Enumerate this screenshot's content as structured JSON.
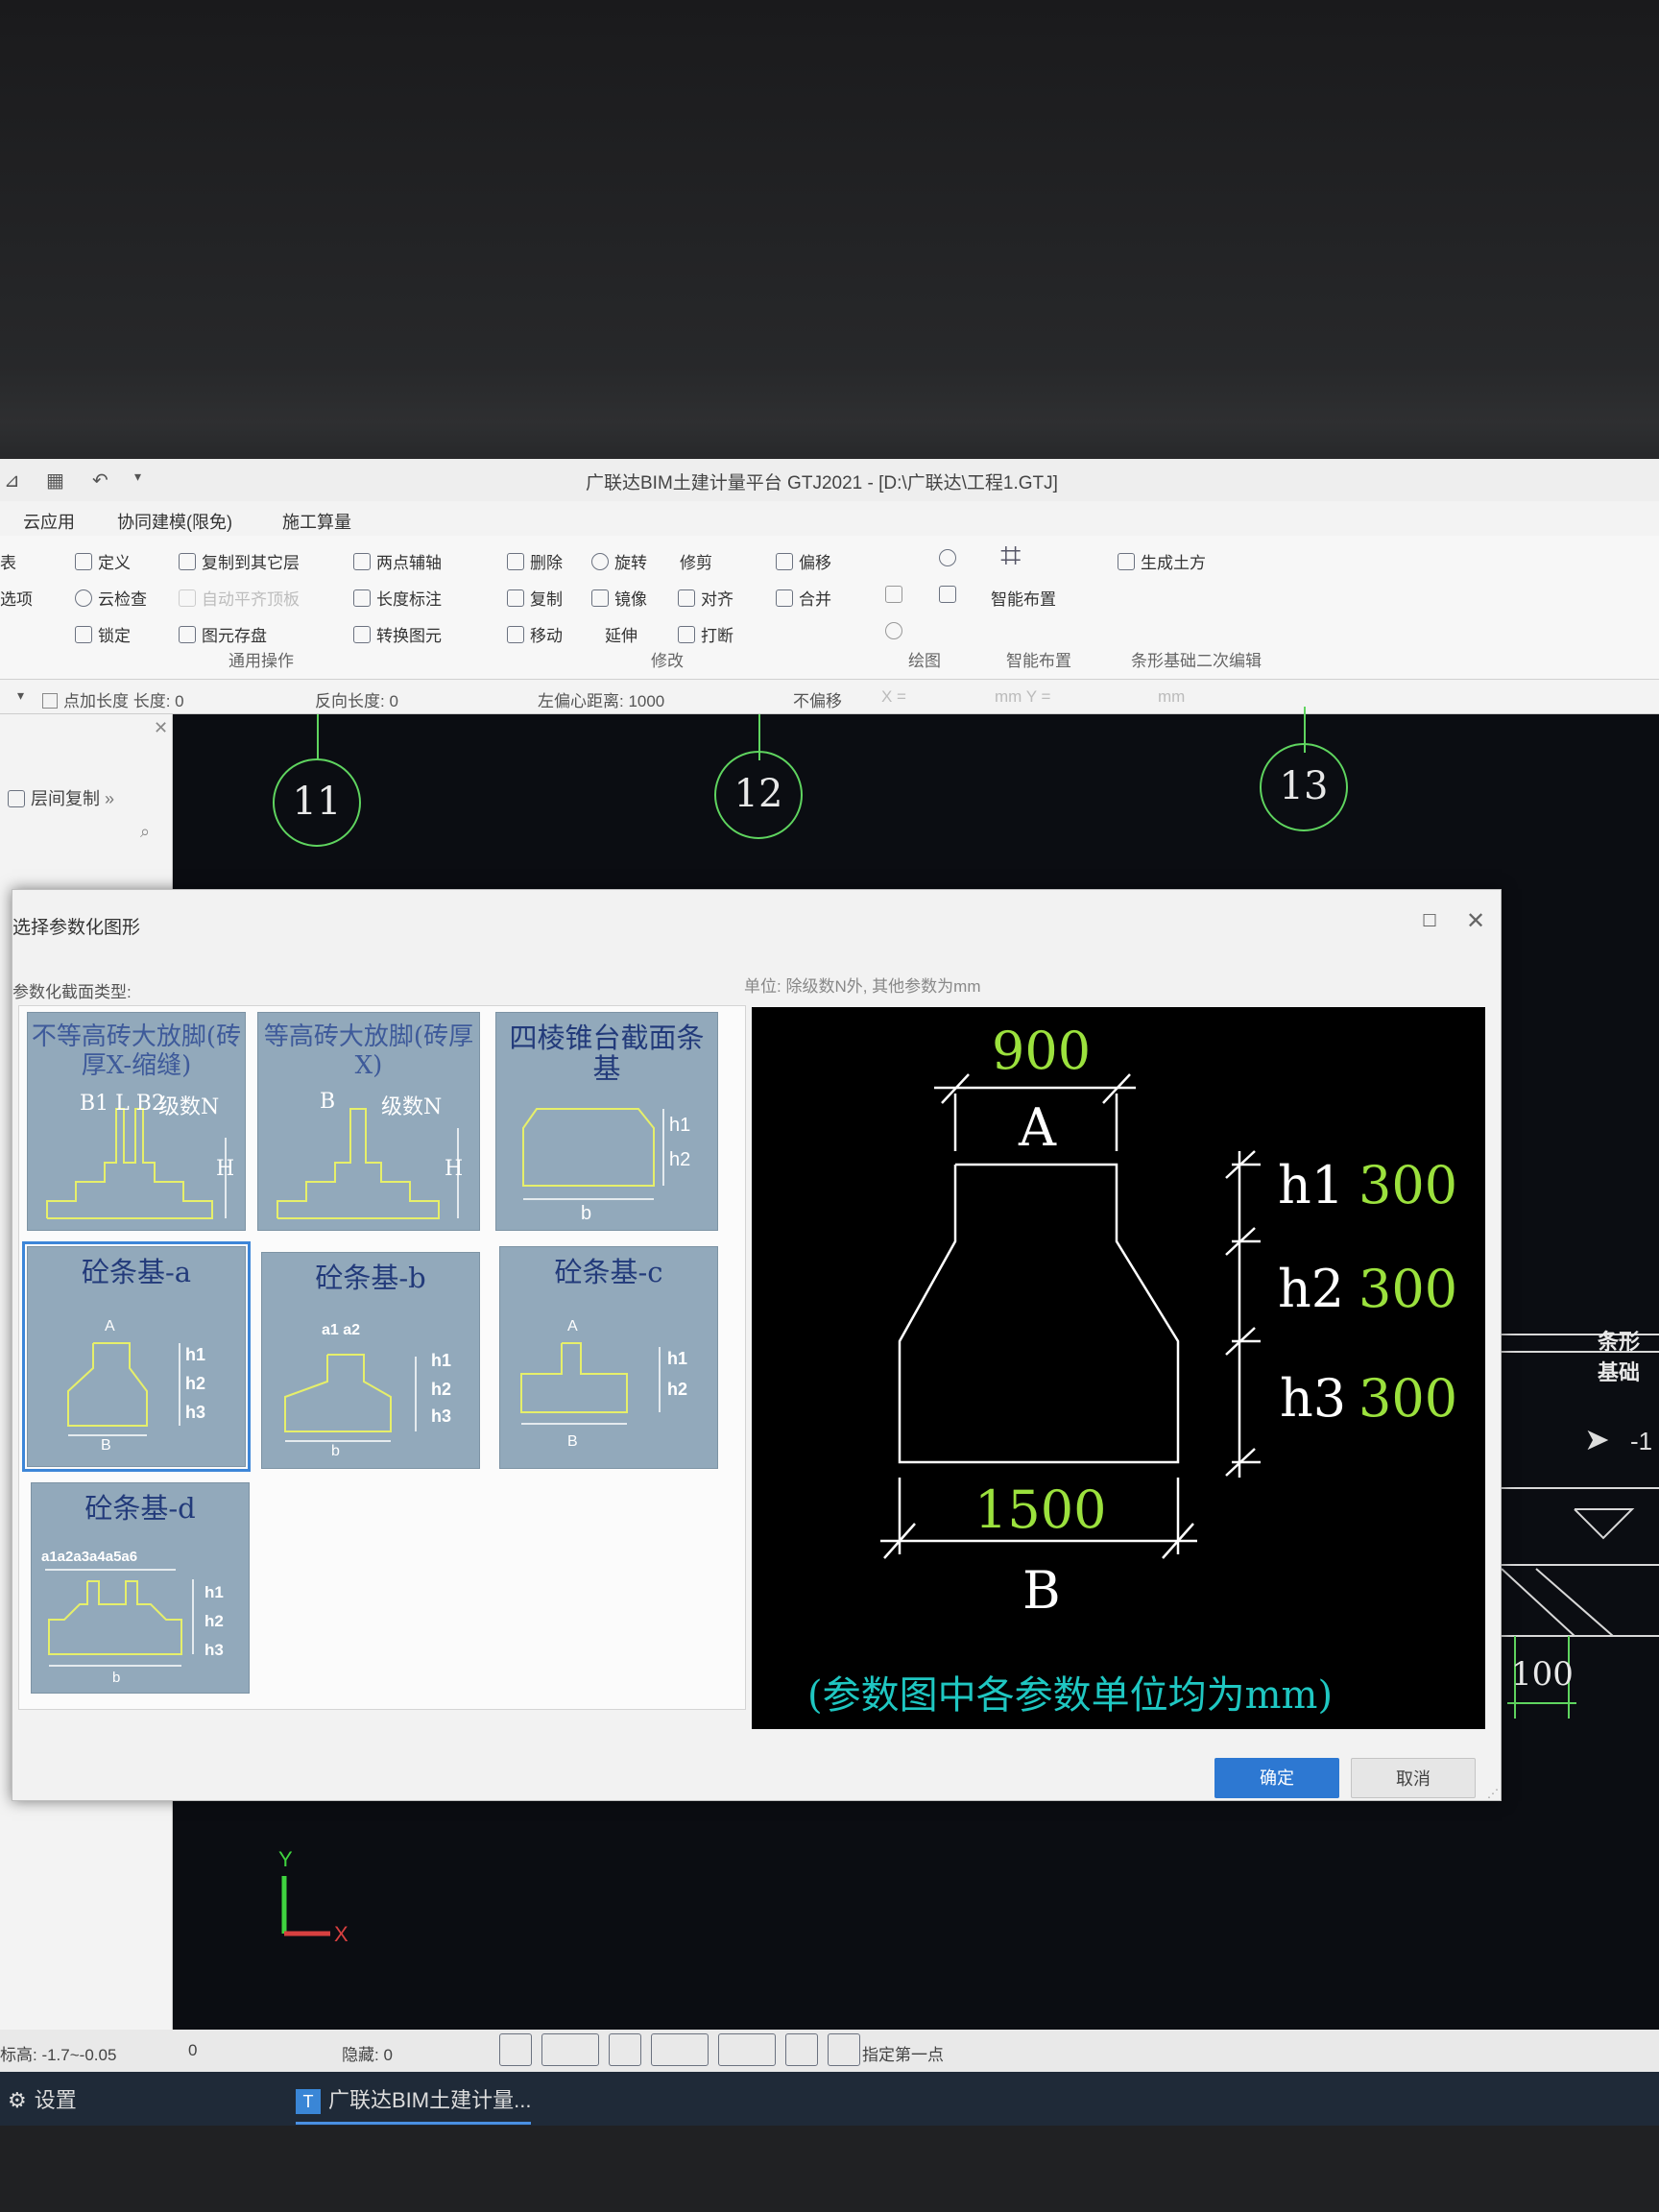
{
  "app": {
    "title": "广联达BIM土建计量平台 GTJ2021 - [D:\\广联达\\工程1.GTJ]"
  },
  "ribbon": {
    "tabs": [
      "云应用",
      "协同建模(限免)",
      "施工算量"
    ],
    "left_cut": [
      "表",
      "选项"
    ],
    "general": [
      "定义",
      "云检查",
      "锁定",
      "复制到其它层",
      "自动平齐顶板",
      "图元存盘",
      "两点辅轴",
      "长度标注",
      "转换图元"
    ],
    "modify": [
      "删除",
      "复制",
      "移动",
      "旋转",
      "镜像",
      "延伸",
      "修剪",
      "对齐",
      "打断",
      "偏移",
      "合并"
    ],
    "smart_layout": "智能布置",
    "generate_earth": "生成土方",
    "groups": [
      "通用操作",
      "修改",
      "绘图",
      "智能布置",
      "条形基础二次编辑"
    ]
  },
  "propbar": {
    "point_add_length": "点加长度 长度: 0",
    "reverse_length": "反向长度: 0",
    "left_offset": "左偏心距离: 1000",
    "no_offset": "不偏移",
    "x_label": "X =",
    "mm_y": "mm Y =",
    "mm": "mm"
  },
  "sidepanel": {
    "floor_copy": "层间复制"
  },
  "canvas": {
    "axes": [
      "11",
      "12",
      "13"
    ],
    "dim_100": "100",
    "right_label": "条形基础",
    "cursor_tag": "-1",
    "y": "Y",
    "x": "X"
  },
  "dialog": {
    "title": "选择参数化图形",
    "section_type_label": "参数化截面类型:",
    "unit_note": "单位: 除级数N外, 其他参数为mm",
    "shapes": [
      {
        "name": "不等高砖大放脚(砖厚X-缩缝)",
        "params": [
          "B1 L B2",
          "级数N",
          "H"
        ]
      },
      {
        "name": "等高砖大放脚(砖厚X)",
        "params": [
          "B",
          "级数N",
          "H"
        ]
      },
      {
        "name": "四棱锥台截面条基",
        "params": [
          "h1",
          "h2",
          "b"
        ]
      },
      {
        "name": "砼条基-a",
        "params": [
          "A",
          "h1",
          "h2",
          "h3",
          "B"
        ]
      },
      {
        "name": "砼条基-b",
        "params": [
          "a1 a2",
          "h1",
          "h2",
          "h3",
          "b"
        ]
      },
      {
        "name": "砼条基-c",
        "params": [
          "A",
          "h1",
          "h2",
          "B"
        ]
      },
      {
        "name": "砼条基-d",
        "params": [
          "a1a2a3a4a5a6",
          "h1",
          "h2",
          "h3",
          "b"
        ]
      }
    ],
    "ok": "确定",
    "cancel": "取消"
  },
  "preview": {
    "a_value": "900",
    "a_label": "A",
    "h1_label": "h1",
    "h1_value": "300",
    "h2_label": "h2",
    "h2_value": "300",
    "h3_label": "h3",
    "h3_value": "300",
    "b_value": "1500",
    "b_label": "B",
    "caption": "(参数图中各参数单位均为mm)"
  },
  "status": {
    "elevation": "标高: -1.7~-0.05",
    "zero": "0",
    "hidden": "隐藏: 0",
    "prompt": "指定第一点"
  },
  "taskbar": {
    "settings": "设置",
    "app": "广联达BIM土建计量..."
  }
}
